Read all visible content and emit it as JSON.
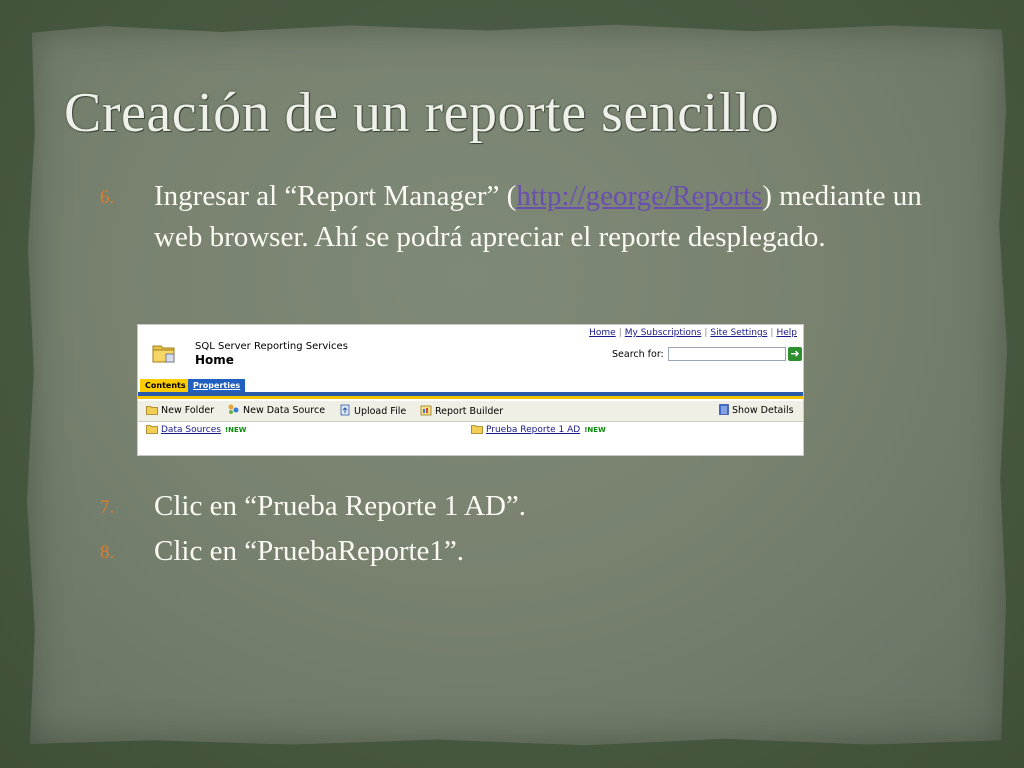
{
  "slide": {
    "title": "Creación de un reporte sencillo",
    "items": [
      {
        "num": "6.",
        "text_before": "Ingresar al “Report Manager” (",
        "link": "http://george/Reports",
        "text_after": ") mediante un web browser. Ahí se podrá apreciar el reporte desplegado."
      },
      {
        "num": "7.",
        "text": "Clic en “Prueba Reporte 1 AD”."
      },
      {
        "num": "8.",
        "text": "Clic en “PruebaReporte1”."
      }
    ]
  },
  "report_manager": {
    "product": "SQL Server Reporting Services",
    "page_title": "Home",
    "top_links": [
      "Home",
      "My Subscriptions",
      "Site Settings",
      "Help"
    ],
    "search_label": "Search for:",
    "search_value": "",
    "go_icon": "arrow-right-icon",
    "tabs": [
      "Contents",
      "Properties"
    ],
    "toolbar": {
      "new_folder": "New Folder",
      "new_data_source": "New Data Source",
      "upload_file": "Upload File",
      "report_builder": "Report Builder",
      "show_details": "Show Details"
    },
    "items": [
      {
        "label": "Data Sources",
        "badge": "NEW"
      },
      {
        "label": "Prueba Reporte 1 AD",
        "badge": "NEW"
      }
    ],
    "colors": {
      "tab_active": "#ffcc00",
      "tab_inactive": "#1f5fbf",
      "bar_blue": "#2a5aaa",
      "bar_yellow": "#f2c200",
      "new_badge": "#0a8a0a"
    }
  },
  "colors": {
    "number_accent": "#e07b2c",
    "link": "#6a4fb0",
    "text": "#fbfbf4"
  }
}
